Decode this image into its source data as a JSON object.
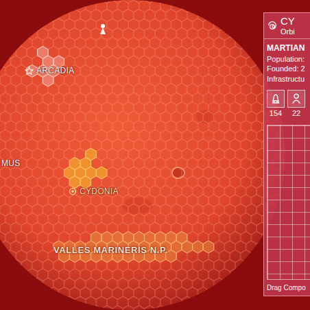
{
  "map": {
    "regions": [
      {
        "label": "ARCADIA",
        "kind": "capital"
      },
      {
        "label": "CYDONIA",
        "kind": "colony"
      },
      {
        "label": "MUS",
        "kind": "plain"
      },
      {
        "label": "VALLES MARINERIS N.P.",
        "kind": "park"
      }
    ]
  },
  "panel": {
    "title": "CY",
    "subtitle": "Orbi",
    "heading": "MARTIAN",
    "fields": [
      "Population:",
      "Founded: 2",
      "Infrastructu"
    ],
    "stats": [
      {
        "value": "154"
      },
      {
        "value": "22"
      }
    ],
    "footer": "Drag Compo"
  }
}
